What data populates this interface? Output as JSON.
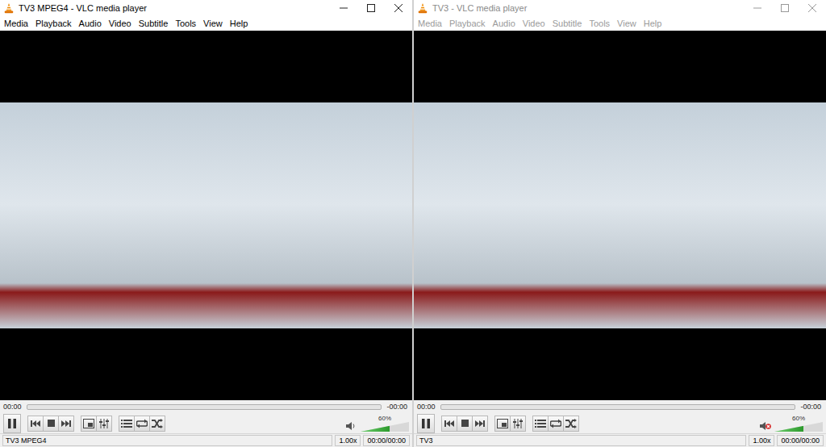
{
  "windows": [
    {
      "title": "TV3 MPEG4 - VLC media player",
      "active": true,
      "menu": [
        "Media",
        "Playback",
        "Audio",
        "Video",
        "Subtitle",
        "Tools",
        "View",
        "Help"
      ],
      "seek": {
        "elapsed": "00:00",
        "remaining": "-00:00",
        "level": 0
      },
      "playing": true,
      "volume": {
        "level": 0.6,
        "reading": "60%",
        "muted": false
      },
      "status": {
        "name": "TV3 MPEG4",
        "speed": "1.00x",
        "time": "00:00/00:00"
      }
    },
    {
      "title": "TV3 - VLC media player",
      "active": false,
      "menu": [
        "Media",
        "Playback",
        "Audio",
        "Video",
        "Subtitle",
        "Tools",
        "View",
        "Help"
      ],
      "seek": {
        "elapsed": "00:00",
        "remaining": "-00:00",
        "level": 0
      },
      "playing": true,
      "volume": {
        "level": 0.6,
        "reading": "60%",
        "muted": true
      },
      "status": {
        "name": "TV3",
        "speed": "1.00x",
        "time": "00:00/00:00"
      }
    }
  ]
}
